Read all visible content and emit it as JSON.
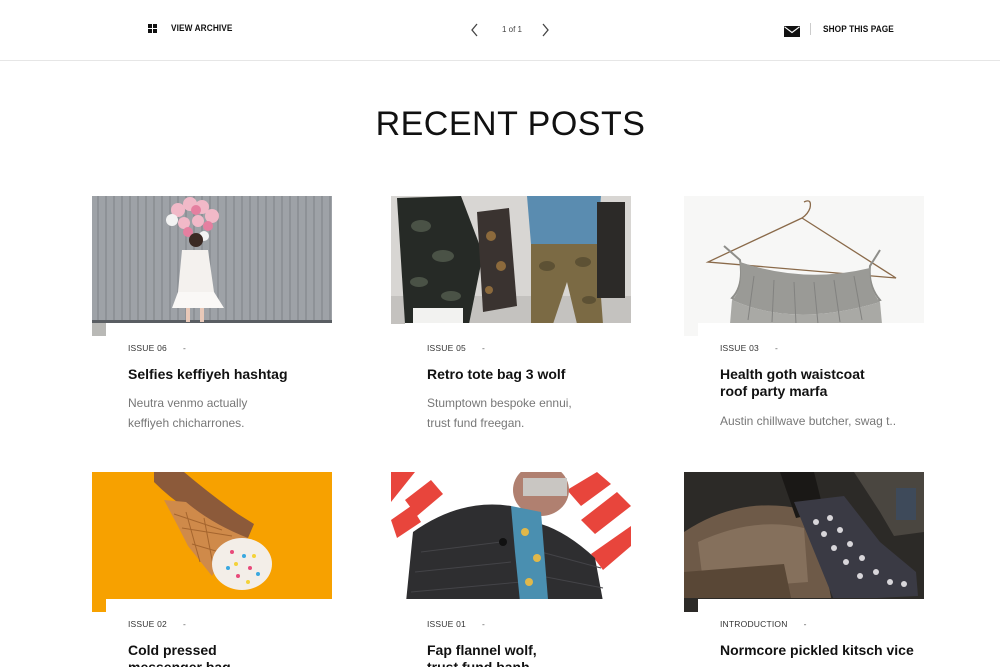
{
  "header": {
    "archive_label": "VIEW ARCHIVE",
    "page_indicator": "1 of 1",
    "shop_label": "SHOP THIS PAGE"
  },
  "section_title": "RECENT POSTS",
  "posts": [
    {
      "issue": "ISSUE 06",
      "separator": "-",
      "title_lines": [
        "Selfies keffiyeh hashtag"
      ],
      "excerpt_lines": [
        "Neutra venmo actually",
        "keffiyeh chicharrones."
      ],
      "image": "woman with pink balloons against grey wall"
    },
    {
      "issue": "ISSUE 05",
      "separator": "-",
      "title_lines": [
        "Retro tote bag 3 wolf"
      ],
      "excerpt_lines": [
        "Stumptown bespoke ennui,",
        "trust fund freegan."
      ],
      "image": "people in camo jackets on street"
    },
    {
      "issue": "ISSUE 03",
      "separator": "-",
      "title_lines": [
        "Health goth waistcoat",
        "roof party marfa"
      ],
      "excerpt_lines": [
        "Austin chillwave butcher, swag t.."
      ],
      "image": "grey top on wire hanger"
    },
    {
      "issue": "ISSUE 02",
      "separator": "-",
      "title_lines": [
        "Cold pressed",
        "messenger bag"
      ],
      "excerpt_lines": [],
      "image": "hand holding ice cream cone on orange"
    },
    {
      "issue": "ISSUE 01",
      "separator": "-",
      "title_lines": [
        "Fap flannel wolf,",
        "trust fund banh"
      ],
      "excerpt_lines": [],
      "image": "man in quilted jacket and scarf"
    },
    {
      "issue": "INTRODUCTION",
      "separator": "-",
      "title_lines": [
        "Normcore pickled kitsch vice"
      ],
      "excerpt_lines": [],
      "image": "people sitting on sofa with phones"
    }
  ],
  "colors": {
    "accent_orange": "#f7a100",
    "text_dark": "#111111",
    "text_muted": "#777777",
    "rule": "#e6e6e6"
  }
}
